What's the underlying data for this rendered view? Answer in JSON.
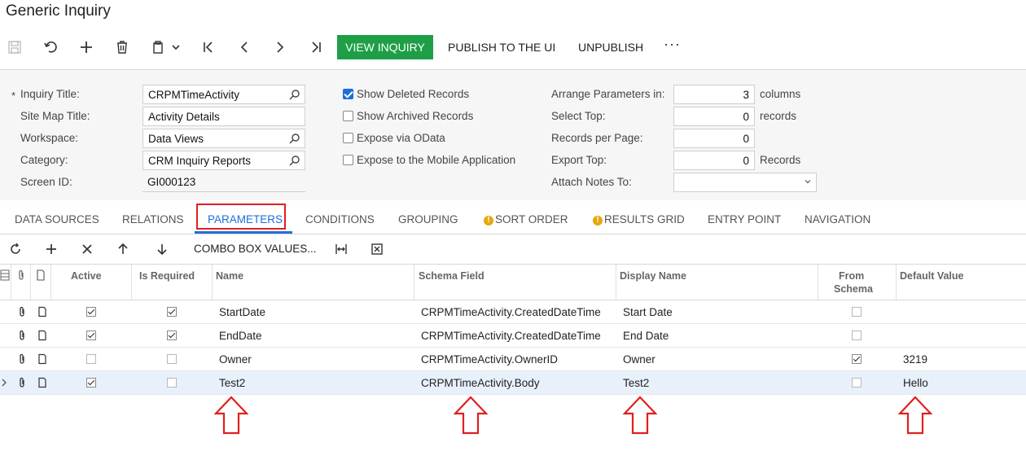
{
  "window": {
    "title": "Generic Inquiry"
  },
  "toolbar": {
    "icons": [
      "save-icon",
      "undo-icon",
      "plus-icon",
      "trash-icon",
      "clipboard-icon",
      "chevron-down-icon",
      "first-icon",
      "prev-icon",
      "next-icon",
      "last-icon"
    ],
    "view_inquiry": "VIEW INQUIRY",
    "publish": "PUBLISH TO THE UI",
    "unpublish": "UNPUBLISH",
    "more": "···",
    "accent_color": "#1e9f47"
  },
  "form": {
    "required_mark": "*",
    "inquiry_title": {
      "label": "Inquiry Title:",
      "value": "CRPMTimeActivity"
    },
    "site_map_title": {
      "label": "Site Map Title:",
      "value": "Activity Details"
    },
    "workspace": {
      "label": "Workspace:",
      "value": "Data Views"
    },
    "category": {
      "label": "Category:",
      "value": "CRM Inquiry Reports"
    },
    "screen_id": {
      "label": "Screen ID:",
      "value": "GI000123"
    },
    "checkboxes": [
      {
        "label": "Show Deleted Records",
        "checked": true
      },
      {
        "label": "Show Archived Records",
        "checked": false
      },
      {
        "label": "Expose via OData",
        "checked": false
      },
      {
        "label": "Expose to the Mobile Application",
        "checked": false
      }
    ],
    "arrange": {
      "label": "Arrange Parameters in:",
      "value": "3",
      "unit": "columns"
    },
    "select_top": {
      "label": "Select Top:",
      "value": "0",
      "unit": "records"
    },
    "records_per_page": {
      "label": "Records per Page:",
      "value": "0"
    },
    "export_top": {
      "label": "Export Top:",
      "value": "0",
      "unit": "Records"
    },
    "attach_notes": {
      "label": "Attach Notes To:",
      "value": ""
    }
  },
  "tabs": [
    {
      "label": "DATA SOURCES",
      "active": false,
      "warning": false
    },
    {
      "label": "RELATIONS",
      "active": false,
      "warning": false
    },
    {
      "label": "PARAMETERS",
      "active": true,
      "warning": false
    },
    {
      "label": "CONDITIONS",
      "active": false,
      "warning": false
    },
    {
      "label": "GROUPING",
      "active": false,
      "warning": false
    },
    {
      "label": "SORT ORDER",
      "active": false,
      "warning": true
    },
    {
      "label": "RESULTS GRID",
      "active": false,
      "warning": true
    },
    {
      "label": "ENTRY POINT",
      "active": false,
      "warning": false
    },
    {
      "label": "NAVIGATION",
      "active": false,
      "warning": false
    }
  ],
  "grid_toolbar": {
    "icons": [
      "refresh-icon",
      "plus-icon",
      "close-icon",
      "arrow-up-icon",
      "arrow-down-icon",
      "fit-columns-icon",
      "excel-icon"
    ],
    "combo_box_values": "COMBO BOX VALUES..."
  },
  "grid": {
    "columns": {
      "active": "Active",
      "is_required": "Is Required",
      "name": "Name",
      "schema_field": "Schema Field",
      "display_name": "Display Name",
      "from_schema_1": "From",
      "from_schema_2": "Schema",
      "default_value": "Default Value"
    },
    "rows": [
      {
        "active": true,
        "is_required": true,
        "name": "StartDate",
        "schema_field": "CRPMTimeActivity.CreatedDateTime",
        "display_name": "Start Date",
        "from_schema": false,
        "default_value": "",
        "selected": false
      },
      {
        "active": true,
        "is_required": true,
        "name": "EndDate",
        "schema_field": "CRPMTimeActivity.CreatedDateTime",
        "display_name": "End Date",
        "from_schema": false,
        "default_value": "",
        "selected": false
      },
      {
        "active": false,
        "is_required": false,
        "name": "Owner",
        "schema_field": "CRPMTimeActivity.OwnerID",
        "display_name": "Owner",
        "from_schema": true,
        "default_value": "3219",
        "selected": false
      },
      {
        "active": true,
        "is_required": false,
        "name": "Test2",
        "schema_field": "CRPMTimeActivity.Body",
        "display_name": "Test2",
        "from_schema": false,
        "default_value": "Hello",
        "selected": true
      }
    ]
  },
  "annotations": {
    "highlight_color": "#e02020"
  }
}
